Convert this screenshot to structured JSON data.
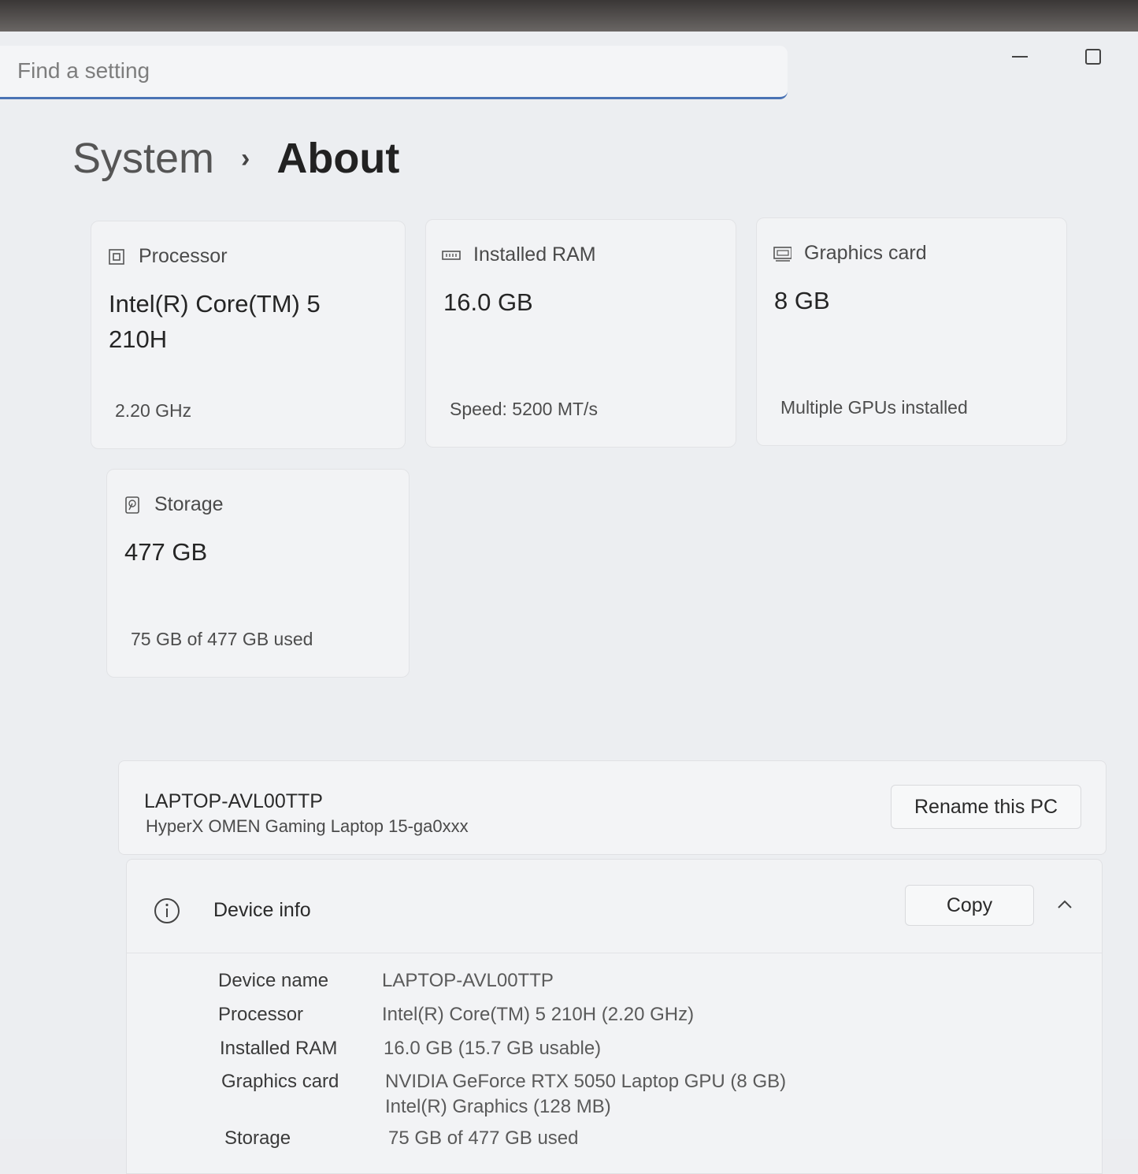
{
  "search": {
    "placeholder": "Find a setting"
  },
  "window_controls": {
    "minimize": "—",
    "maximize": "☐"
  },
  "breadcrumb": {
    "root": "System",
    "separator": "›",
    "current": "About"
  },
  "cards": {
    "processor": {
      "title": "Processor",
      "value": "Intel(R) Core(TM) 5 210H",
      "sub": "2.20 GHz",
      "icon": "processor-icon"
    },
    "ram": {
      "title": "Installed RAM",
      "value": "16.0 GB",
      "sub": "Speed: 5200 MT/s",
      "icon": "ram-icon"
    },
    "graphics": {
      "title": "Graphics card",
      "value": "8 GB",
      "sub": "Multiple GPUs installed",
      "icon": "graphics-card-icon"
    },
    "storage": {
      "title": "Storage",
      "value": "477 GB",
      "sub": "75 GB of 477 GB used",
      "icon": "storage-icon"
    }
  },
  "pc": {
    "name": "LAPTOP-AVL00TTP",
    "model": "HyperX OMEN Gaming Laptop 15-ga0xxx",
    "rename_label": "Rename this PC"
  },
  "device_info": {
    "title": "Device info",
    "copy_label": "Copy",
    "rows": {
      "device_name": {
        "label": "Device name",
        "value": "LAPTOP-AVL00TTP"
      },
      "processor": {
        "label": "Processor",
        "value": "Intel(R) Core(TM) 5 210H (2.20 GHz)"
      },
      "ram": {
        "label": "Installed RAM",
        "value": "16.0 GB (15.7 GB usable)"
      },
      "graphics": {
        "label": "Graphics card",
        "value": "NVIDIA GeForce RTX 5050 Laptop GPU (8 GB)",
        "value2": "Intel(R) Graphics (128 MB)"
      },
      "storage": {
        "label": "Storage",
        "value": "75 GB of 477 GB used"
      }
    }
  }
}
